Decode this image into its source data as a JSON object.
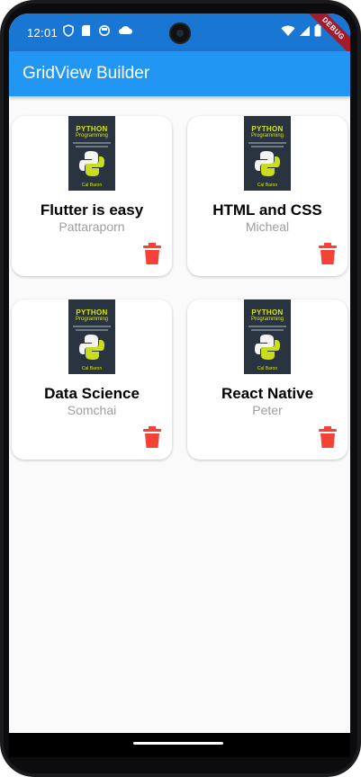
{
  "status_bar": {
    "time": "12:01",
    "debug_label": "DEBUG"
  },
  "app_bar": {
    "title": "GridView Builder",
    "color": "#2196f3"
  },
  "books": [
    {
      "title": "Flutter is easy",
      "author": "Pattaraporn",
      "cover_title": "PYTHON",
      "cover_subtitle": "Programming",
      "cover_author": "Cal Baron"
    },
    {
      "title": "HTML and CSS",
      "author": "Micheal",
      "cover_title": "PYTHON",
      "cover_subtitle": "Programming",
      "cover_author": "Cal Baron"
    },
    {
      "title": "Data Science",
      "author": "Somchai",
      "cover_title": "PYTHON",
      "cover_subtitle": "Programming",
      "cover_author": "Cal Baron"
    },
    {
      "title": "React Native",
      "author": "Peter",
      "cover_title": "PYTHON",
      "cover_subtitle": "Programming",
      "cover_author": "Cal Baron"
    }
  ],
  "colors": {
    "delete": "#f44336",
    "author_text": "#9e9e9e"
  },
  "icons": {
    "delete": "trash-icon",
    "wifi": "wifi-icon",
    "signal": "signal-icon",
    "battery": "battery-icon"
  }
}
